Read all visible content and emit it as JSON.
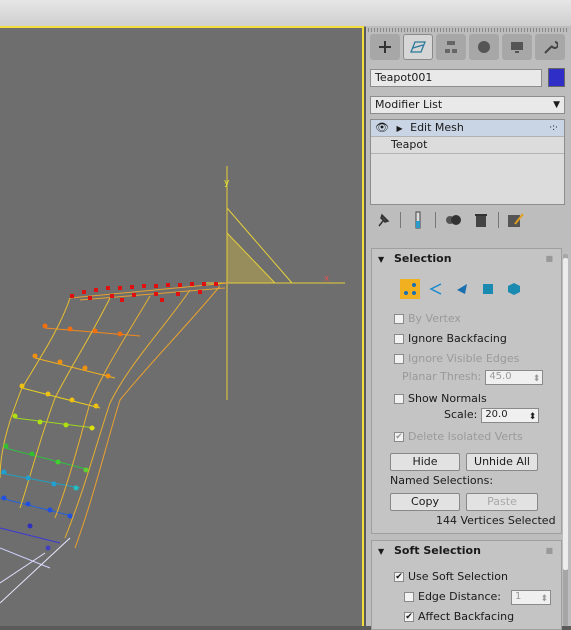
{
  "object": {
    "name": "Teapot001",
    "color": "#2f2fc8"
  },
  "modifier_list": {
    "label": "Modifier List"
  },
  "stack": {
    "items": [
      "Edit Mesh",
      "Teapot"
    ]
  },
  "viewport": {
    "axis_x": "x",
    "axis_y": "y",
    "border_color": "#f2de3a"
  },
  "selection": {
    "title": "Selection",
    "by_vertex": "By Vertex",
    "ignore_backfacing": "Ignore Backfacing",
    "ignore_visible_edges": "Ignore Visible Edges",
    "planar_thresh_label": "Planar Thresh:",
    "planar_thresh_value": "45.0",
    "show_normals": "Show Normals",
    "scale_label": "Scale:",
    "scale_value": "20.0",
    "delete_isolated": "Delete Isolated Verts",
    "hide": "Hide",
    "unhide_all": "Unhide All",
    "named_selections": "Named Selections:",
    "copy": "Copy",
    "paste": "Paste",
    "status": "144 Vertices Selected"
  },
  "soft_selection": {
    "title": "Soft Selection",
    "use_soft": "Use Soft Selection",
    "edge_distance": "Edge Distance:",
    "edge_distance_value": "1",
    "affect_backfacing": "Affect Backfacing"
  }
}
